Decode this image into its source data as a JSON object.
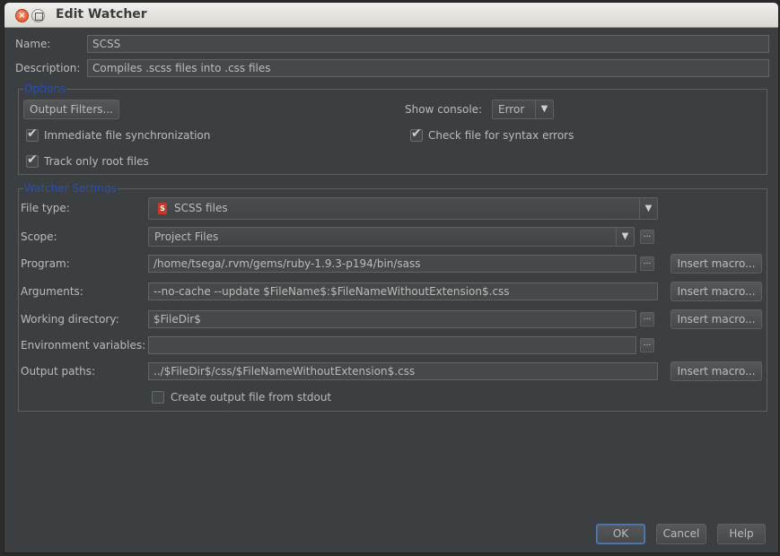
{
  "window": {
    "title": "Edit Watcher"
  },
  "form": {
    "name_label": "Name:",
    "name_value": "SCSS",
    "description_label": "Description:",
    "description_value": "Compiles .scss files into .css files"
  },
  "options": {
    "legend": "Options",
    "output_filters_label": "Output Filters...",
    "show_console_label": "Show console:",
    "show_console_value": "Error",
    "immediate_sync_label": "Immediate file synchronization",
    "immediate_sync_checked": true,
    "syntax_check_label": "Check file for syntax errors",
    "syntax_check_checked": true,
    "track_root_label": "Track only root files",
    "track_root_checked": true
  },
  "watcher": {
    "legend": "Watcher Settings",
    "file_type_label": "File type:",
    "file_type_value": "SCSS files",
    "file_type_icon_glyph": "S",
    "scope_label": "Scope:",
    "scope_value": "Project Files",
    "program_label": "Program:",
    "program_value": "/home/tsega/.rvm/gems/ruby-1.9.3-p194/bin/sass",
    "arguments_label": "Arguments:",
    "arguments_value": "--no-cache --update $FileName$:$FileNameWithoutExtension$.css",
    "working_dir_label": "Working directory:",
    "working_dir_value": "$FileDir$",
    "env_vars_label": "Environment variables:",
    "env_vars_value": "",
    "output_paths_label": "Output paths:",
    "output_paths_value": "../$FileDir$/css/$FileNameWithoutExtension$.css",
    "stdout_label": "Create output file from stdout",
    "stdout_checked": false,
    "insert_macro_label": "Insert macro...",
    "ellipsis_label": "..."
  },
  "footer": {
    "ok_label": "OK",
    "cancel_label": "Cancel",
    "help_label": "Help"
  },
  "colors": {
    "dialog_bg": "#3c3f41",
    "legend": "#2750b5",
    "field_bg": "#45494a",
    "file_icon": "#c0392b"
  }
}
